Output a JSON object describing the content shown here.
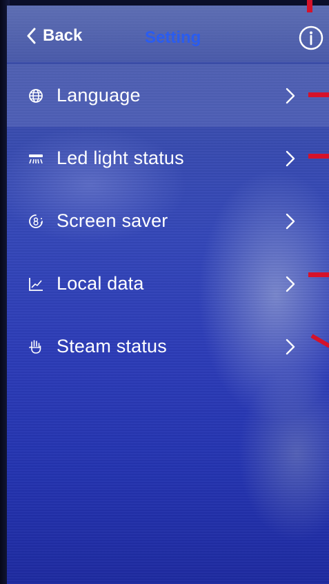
{
  "header": {
    "back_label": "Back",
    "title": "Setting",
    "back_icon": "chevron-left-icon",
    "info_icon": "info-circle-icon"
  },
  "menu": {
    "items": [
      {
        "label": "Language",
        "icon": "globe-icon"
      },
      {
        "label": "Led light status",
        "icon": "ceiling-light-icon"
      },
      {
        "label": "Screen saver",
        "icon": "timer-8-icon"
      },
      {
        "label": "Local data",
        "icon": "line-chart-icon"
      },
      {
        "label": "Steam status",
        "icon": "steam-hand-icon"
      }
    ]
  },
  "colors": {
    "title": "#2a5cf0",
    "text": "#ffffff",
    "annotation": "#d5122a",
    "background": "#3447b8"
  }
}
